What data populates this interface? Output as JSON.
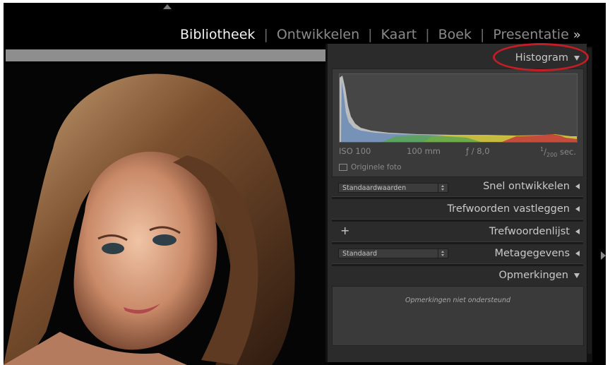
{
  "modules": {
    "items": [
      "Bibliotheek",
      "Ontwikkelen",
      "Kaart",
      "Boek",
      "Presentatie"
    ],
    "separator": "|",
    "active": "Bibliotheek",
    "more": "»"
  },
  "histogram": {
    "header": "Histogram",
    "iso": "ISO 100",
    "focal": "100 mm",
    "aperture": "ƒ / 8,0",
    "shutter_num": "1",
    "shutter_den": "200",
    "shutter_unit": "sec.",
    "original_label": "Originele foto"
  },
  "quick_develop": {
    "preset": "Standaardwaarden",
    "header": "Snel ontwikkelen"
  },
  "keywording": {
    "header": "Trefwoorden vastleggen"
  },
  "keyword_list": {
    "plus": "+",
    "header": "Trefwoordenlijst"
  },
  "metadata": {
    "preset": "Standaard",
    "header": "Metagegevens"
  },
  "comments": {
    "header": "Opmerkingen",
    "placeholder": "Opmerkingen niet ondersteund"
  }
}
